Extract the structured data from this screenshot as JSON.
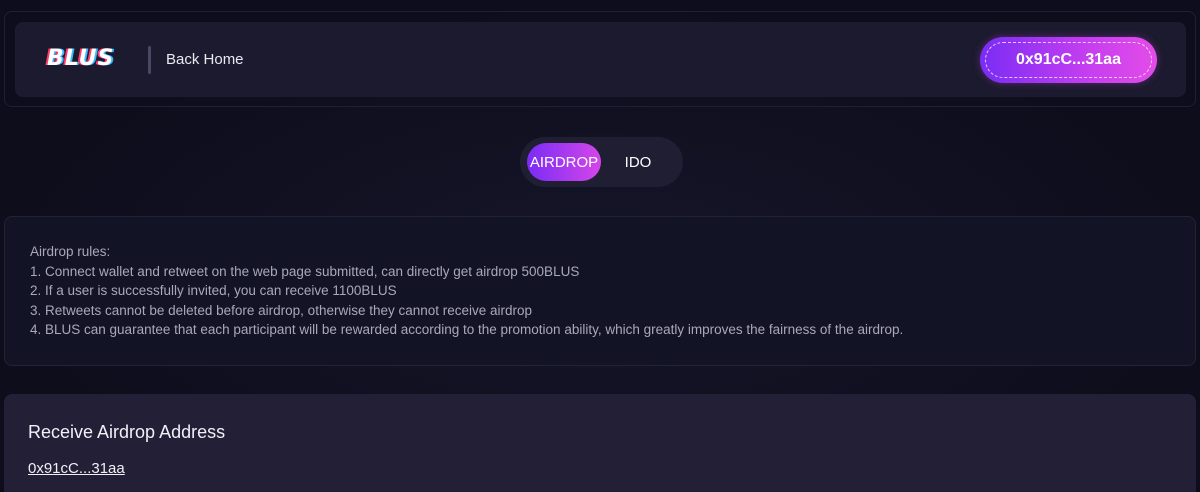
{
  "header": {
    "logo": "BLUS",
    "back_home_label": "Back Home",
    "wallet_label": "0x91cC...31aa"
  },
  "tabs": [
    {
      "label": "AIRDROP",
      "active": true
    },
    {
      "label": "IDO",
      "active": false
    }
  ],
  "rules": {
    "title": "Airdrop rules:",
    "items": [
      "1. Connect wallet and retweet on the web page submitted, can directly get airdrop 500BLUS",
      "2. If a user is successfully invited, you can receive 1100BLUS",
      "3. Retweets cannot be deleted before airdrop, otherwise they cannot receive airdrop",
      "4. BLUS can guarantee that each participant will be rewarded according to the promotion ability, which greatly improves the fairness of the airdrop."
    ]
  },
  "address": {
    "title": "Receive Airdrop Address",
    "value": "0x91cC...31aa"
  },
  "colors": {
    "background": "#0d0d1c",
    "panel": "#1c1a2e",
    "accent_start": "#7a2cf5",
    "accent_end": "#e44ce8",
    "muted_text": "#a9a8b8"
  }
}
